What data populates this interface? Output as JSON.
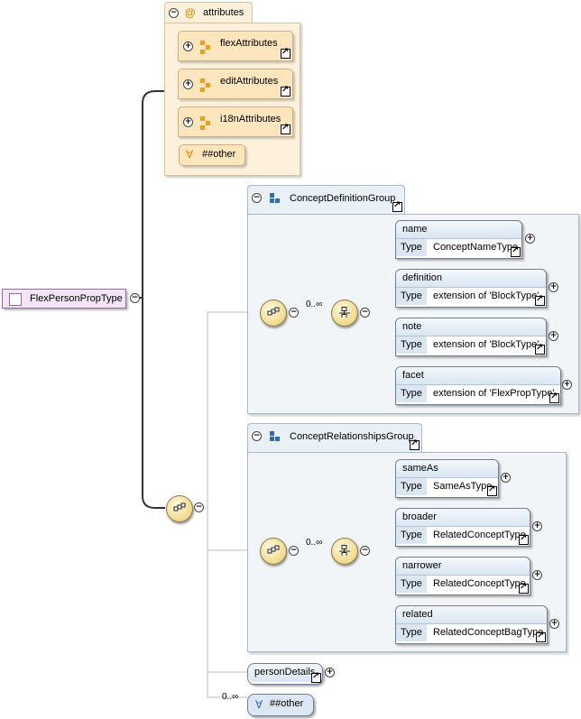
{
  "root": {
    "label": "FlexPersonPropType"
  },
  "attributes": {
    "title": "attributes",
    "items": [
      {
        "label": "flexAttributes"
      },
      {
        "label": "editAttributes"
      },
      {
        "label": "i18nAttributes"
      }
    ],
    "other": "##other"
  },
  "groups": [
    {
      "title": "ConceptDefinitionGroup",
      "occurrence": "0..∞",
      "type_label": "Type",
      "elements": [
        {
          "name": "name",
          "type": "ConceptNameType"
        },
        {
          "name": "definition",
          "type": "extension of 'BlockType'"
        },
        {
          "name": "note",
          "type": "extension of 'BlockType'"
        },
        {
          "name": "facet",
          "type": "extension of 'FlexPropType'"
        }
      ]
    },
    {
      "title": "ConceptRelationshipsGroup",
      "occurrence": "0..∞",
      "type_label": "Type",
      "elements": [
        {
          "name": "sameAs",
          "type": "SameAsType"
        },
        {
          "name": "broader",
          "type": "RelatedConceptType"
        },
        {
          "name": "narrower",
          "type": "RelatedConceptType"
        },
        {
          "name": "related",
          "type": "RelatedConceptBagType"
        }
      ]
    }
  ],
  "person_details": "personDetails",
  "any_other": {
    "occurrence": "0..∞",
    "label": "##other"
  },
  "colors": {
    "attributes_bg": "#fdf1dc",
    "group_bg": "#f2f5f8",
    "root_bg": "#f3e4f6"
  }
}
